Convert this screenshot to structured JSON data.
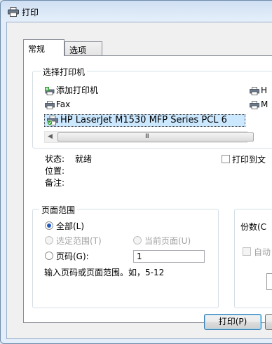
{
  "window": {
    "title": "打印"
  },
  "tabs": [
    {
      "label": "常规",
      "active": true
    },
    {
      "label": "选项",
      "active": false
    }
  ],
  "select_printer": {
    "group_label": "选择打印机",
    "items": [
      {
        "label": "添加打印机",
        "icon": "add-printer-icon"
      },
      {
        "label": "Fax",
        "icon": "fax-printer-icon"
      },
      {
        "label": "H",
        "icon": "printer-icon"
      },
      {
        "label": "M",
        "icon": "printer-icon"
      }
    ],
    "selected": {
      "label": "HP LaserJet M1530 MFP Series PCL 6",
      "icon": "default-printer-icon"
    },
    "scroll_grip": "III",
    "status_label": "状态:",
    "status_value": "就绪",
    "location_label": "位置:",
    "comment_label": "备注:",
    "print_to_file_label": "打印到文"
  },
  "page_range": {
    "group_label": "页面范围",
    "all_label": "全部(L)",
    "selection_label": "选定范围(T)",
    "current_page_label": "当前页面(U)",
    "pages_label": "页码(G):",
    "pages_value": "1",
    "hint": "输入页码或页面范围。如，5-12"
  },
  "copies": {
    "label": "份数(C",
    "collate_label": "自动"
  },
  "buttons": {
    "print_label": "打印(P)"
  },
  "colors": {
    "selection_bg": "#cce8ff",
    "title_bar": "#dae7f6",
    "radio_accent": "#1e5bc0"
  }
}
